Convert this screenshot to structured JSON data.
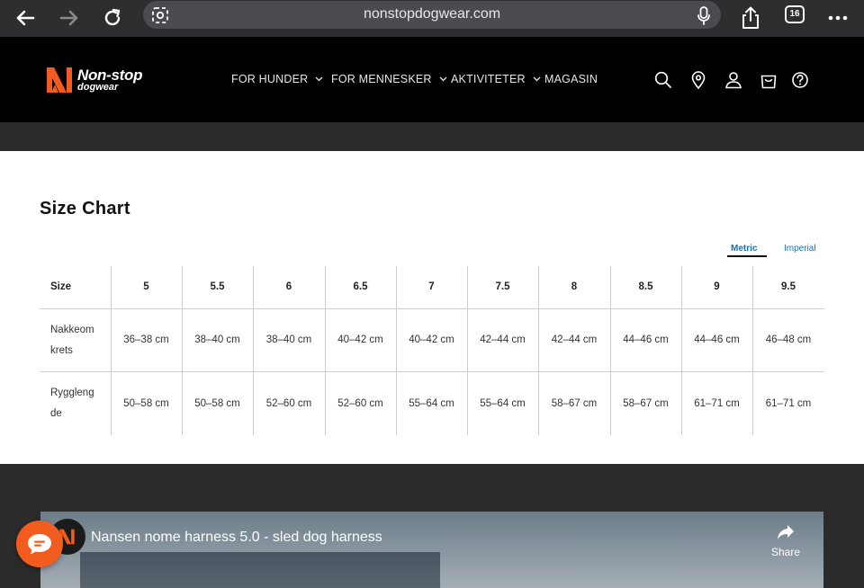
{
  "browser": {
    "url": "nonstopdogwear.com",
    "tab_count": "16"
  },
  "header": {
    "logo_main": "Non-stop",
    "logo_sub": "dogwear",
    "nav": [
      {
        "label": "FOR HUNDER"
      },
      {
        "label": "FOR MENNESKER"
      },
      {
        "label": "AKTIVITETER"
      },
      {
        "label": "MAGASIN"
      }
    ]
  },
  "size_chart": {
    "title": "Size Chart",
    "unit_tabs": {
      "metric": "Metric",
      "imperial": "Imperial"
    },
    "selected_unit": "Metric",
    "columns": [
      "Size",
      "5",
      "5.5",
      "6",
      "6.5",
      "7",
      "7.5",
      "8",
      "8.5",
      "9",
      "9.5"
    ],
    "rows": [
      {
        "label": "Nakkeom krets",
        "values": [
          "36–38 cm",
          "38–40 cm",
          "38–40 cm",
          "40–42 cm",
          "40–42 cm",
          "42–44 cm",
          "42–44 cm",
          "44–46 cm",
          "44–46 cm",
          "46–48 cm"
        ]
      },
      {
        "label": "Ryggleng de",
        "values": [
          "50–58 cm",
          "50–58 cm",
          "52–60 cm",
          "52–60 cm",
          "55–64 cm",
          "55–64 cm",
          "58–67 cm",
          "58–67 cm",
          "61–71 cm",
          "61–71 cm"
        ]
      }
    ]
  },
  "video": {
    "title": "Nansen nome harness 5.0 - sled dog harness",
    "share_label": "Share"
  },
  "colors": {
    "brand_orange": "#f25c1f",
    "link_blue": "#1a6fb5",
    "header_bg": "#000000"
  }
}
